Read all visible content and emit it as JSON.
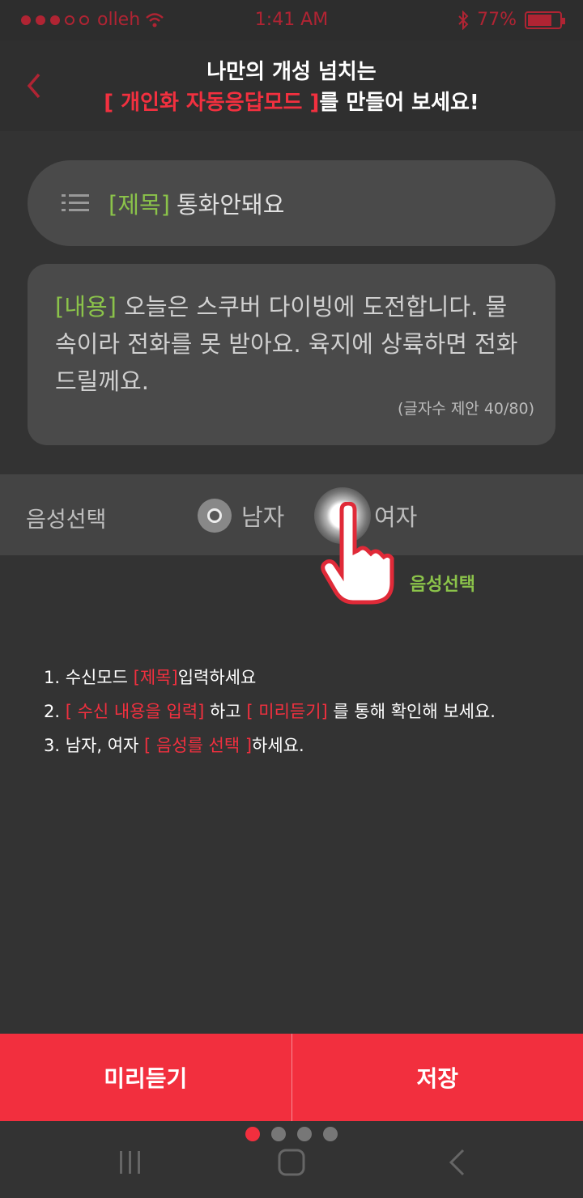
{
  "status_bar": {
    "carrier": "olleh",
    "time": "1:41 AM",
    "battery": "77%",
    "battery_level": 0.77
  },
  "header": {
    "line1": "나만의 개성 넘치는",
    "line2_highlight": "[ 개인화 자동응답모드 ]",
    "line2_rest": "를 만들어 보세요!"
  },
  "title_field": {
    "tag": "[제목]",
    "value": "통화안돼요"
  },
  "content_field": {
    "tag": "[내용]",
    "text": " 오늘은 스쿠버 다이빙에 도전합니다. 물속이라 전화를 못 받아요. 육지에 상륙하면 전화드릴께요.",
    "counter": "(글자수 제안 40/80)"
  },
  "voice": {
    "label": "음성선택",
    "male": "남자",
    "female": "여자",
    "hint": "음성선택"
  },
  "instructions": [
    {
      "num": "1. 수신모드 ",
      "hl": "[제목]",
      "rest": "입력하세요"
    },
    {
      "num": "2. ",
      "hl": "[ 수신 내용을 입력]",
      "mid": " 하고 ",
      "hl2": "[ 미리듣기]",
      "rest": " 를 통해 확인해 보세요."
    },
    {
      "num": "3. 남자, 여자 ",
      "hl": "[ 음성를 선택 ]",
      "rest": "하세요."
    }
  ],
  "bottom": {
    "preview": "미리듣기",
    "save": "저장"
  },
  "pager": {
    "count": 4,
    "active": 1
  },
  "colors": {
    "accent": "#f22f3e",
    "tag_green": "#8bc34a",
    "background": "#333333"
  },
  "icons": [
    "back-chevron-icon",
    "list-icon",
    "hand-pointer-icon",
    "recent-apps-icon",
    "home-icon",
    "nav-back-icon"
  ]
}
